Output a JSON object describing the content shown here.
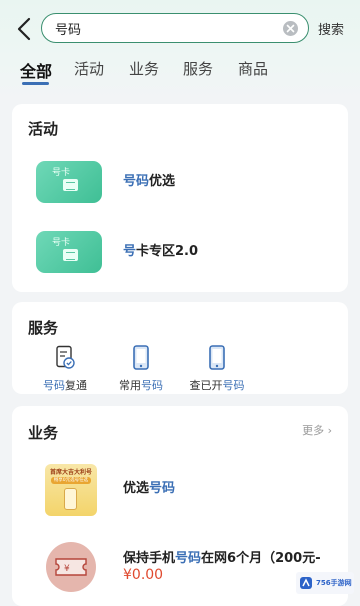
{
  "search": {
    "value": "号码",
    "button_label": "搜索"
  },
  "tabs": [
    {
      "label": "全部",
      "active": true
    },
    {
      "label": "活动",
      "active": false
    },
    {
      "label": "业务",
      "active": false
    },
    {
      "label": "服务",
      "active": false
    },
    {
      "label": "商品",
      "active": false
    }
  ],
  "activity": {
    "title": "活动",
    "items": [
      {
        "thumb_label": "号卡",
        "label_hl": "号码",
        "label_rest": "优选"
      },
      {
        "thumb_label": "号卡",
        "label_hl": "号",
        "label_rest": "卡专区2.0"
      }
    ]
  },
  "service": {
    "title": "服务",
    "items": [
      {
        "label_hl": "号码",
        "label_rest": "复通",
        "icon": "document-icon"
      },
      {
        "label_pre": "常用",
        "label_hl": "号码",
        "icon": "phone-icon"
      },
      {
        "label_pre": "查已开",
        "label_hl": "号码",
        "icon": "phone-icon"
      }
    ]
  },
  "business": {
    "title": "业务",
    "more_label": "更多",
    "items": [
      {
        "label_pre": "优选",
        "label_hl": "号码",
        "thumb_line1": "首席大吉大利号",
        "thumb_line2": "畅享0元选号任选"
      },
      {
        "label_pre": "保持手机",
        "label_hl": "号码",
        "label_rest": "在网6个月（200元-",
        "price": "¥0.00"
      }
    ]
  },
  "watermark": {
    "text": "756手游网"
  },
  "colors": {
    "accent_blue": "#3b6fb5",
    "search_border": "#3a8f6f",
    "price_red": "#e04a2f"
  }
}
